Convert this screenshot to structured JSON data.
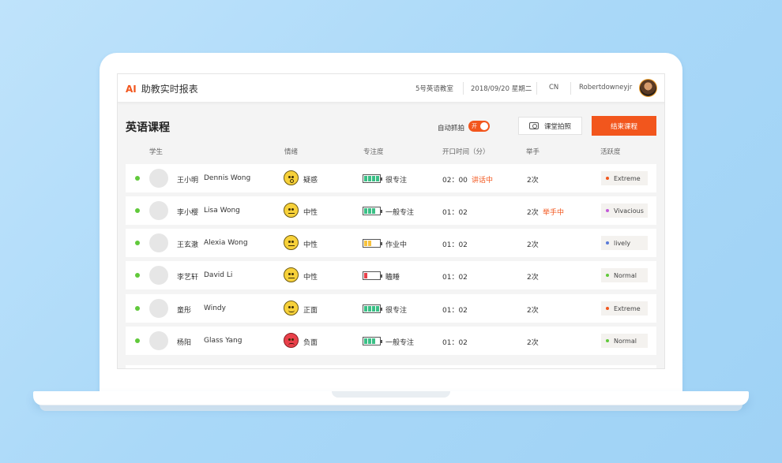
{
  "header": {
    "brand_ai": "AI",
    "app_title": "助教实时报表",
    "classroom": "5号英语教室",
    "datetime": "2018/09/20  星期二",
    "language": "CN",
    "username": "Robertdowneyjr"
  },
  "toolbar": {
    "course_title": "英语课程",
    "auto_capture_label": "自动抓拍",
    "toggle_label": "开",
    "photo_button_label": "课堂拍照",
    "end_button_label": "结束课程"
  },
  "columns": {
    "student": "学生",
    "emotion": "情绪",
    "focus": "专注度",
    "speaking_time": "开口时间（分）",
    "hand": "举手",
    "activity": "活跃度"
  },
  "colors": {
    "accent": "#f2561d",
    "online": "#61c93b",
    "battery_green": "#3bbf86",
    "battery_yellow": "#f6c23e",
    "battery_red": "#e9404a"
  },
  "rows": [
    {
      "cn_name": "王小明",
      "en_name": "Dennis Wong",
      "emotion": "疑惑",
      "emotion_icon": "surprised-face-icon",
      "focus": "很专注",
      "focus_level": 4,
      "time": "02：00",
      "time_note": "讲话中",
      "hand": "2次",
      "hand_note": "",
      "activity": "Extreme",
      "activity_color": "#f2561d"
    },
    {
      "cn_name": "李小樱",
      "en_name": "Lisa Wong",
      "emotion": "中性",
      "emotion_icon": "neutral-face-icon",
      "focus": "一般专注",
      "focus_level": 3,
      "time": "01：02",
      "time_note": "",
      "hand": "2次",
      "hand_note": "举手中",
      "activity": "Vivacious",
      "activity_color": "#c25ad8"
    },
    {
      "cn_name": "王玄澈",
      "en_name": "Alexia Wong",
      "emotion": "中性",
      "emotion_icon": "neutral-face-icon",
      "focus": "作业中",
      "focus_level": 2,
      "time": "01：02",
      "time_note": "",
      "hand": "2次",
      "hand_note": "",
      "activity": "lively",
      "activity_color": "#5a7bd8"
    },
    {
      "cn_name": "李艺轩",
      "en_name": "David Li",
      "emotion": "中性",
      "emotion_icon": "neutral-face-icon",
      "focus": "瞌睡",
      "focus_level": 1,
      "time": "01：02",
      "time_note": "",
      "hand": "2次",
      "hand_note": "",
      "activity": "Normal",
      "activity_color": "#61c93b"
    },
    {
      "cn_name": "童彤",
      "en_name": "Windy",
      "emotion": "正面",
      "emotion_icon": "happy-face-icon",
      "focus": "很专注",
      "focus_level": 4,
      "time": "01：02",
      "time_note": "",
      "hand": "2次",
      "hand_note": "",
      "activity": "Extreme",
      "activity_color": "#f2561d"
    },
    {
      "cn_name": "杨阳",
      "en_name": "Glass Yang",
      "emotion": "负面",
      "emotion_icon": "angry-face-icon",
      "focus": "一般专注",
      "focus_level": 3,
      "time": "01：02",
      "time_note": "",
      "hand": "2次",
      "hand_note": "",
      "activity": "Normal",
      "activity_color": "#61c93b"
    }
  ]
}
